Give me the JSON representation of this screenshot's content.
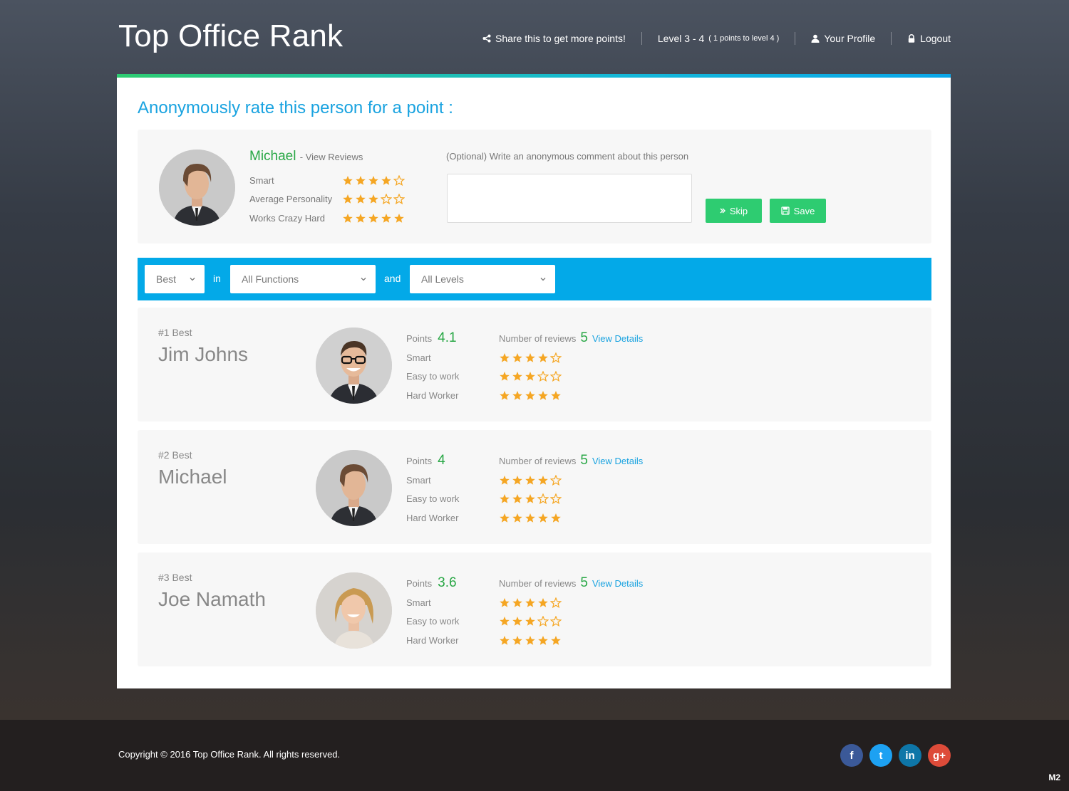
{
  "app": {
    "title": "Top Office Rank"
  },
  "nav": {
    "share_label": "Share this to get more points!",
    "level_label": "Level 3 - 4",
    "level_note": "( 1 points to level 4 )",
    "profile_label": "Your Profile",
    "logout_label": "Logout"
  },
  "rate": {
    "title": "Anonymously rate this person for a point :",
    "person_name": "Michael",
    "view_reviews": "- View Reviews",
    "traits": [
      {
        "label": "Smart",
        "rating": 4
      },
      {
        "label": "Average Personality",
        "rating": 3
      },
      {
        "label": "Works Crazy Hard",
        "rating": 5
      }
    ],
    "comment_label": "(Optional) Write an anonymous comment about this person",
    "comment_value": "",
    "skip_label": "Skip",
    "save_label": "Save"
  },
  "filters": {
    "sort_value": "Best",
    "word_in": "in",
    "function_value": "All Functions",
    "word_and": "and",
    "level_value": "All Levels"
  },
  "rankings": [
    {
      "rank_label": "#1 Best",
      "name": "Jim Johns",
      "points_label": "Points",
      "points": "4.1",
      "reviews_label": "Number of reviews",
      "reviews": "5",
      "details_label": "View Details",
      "traits": [
        {
          "label": "Smart",
          "rating": 4
        },
        {
          "label": "Easy to work",
          "rating": 3
        },
        {
          "label": "Hard Worker",
          "rating": 5
        }
      ]
    },
    {
      "rank_label": "#2 Best",
      "name": "Michael",
      "points_label": "Points",
      "points": "4",
      "reviews_label": "Number of reviews",
      "reviews": "5",
      "details_label": "View Details",
      "traits": [
        {
          "label": "Smart",
          "rating": 4
        },
        {
          "label": "Easy to work",
          "rating": 3
        },
        {
          "label": "Hard Worker",
          "rating": 5
        }
      ]
    },
    {
      "rank_label": "#3 Best",
      "name": "Joe Namath",
      "points_label": "Points",
      "points": "3.6",
      "reviews_label": "Number of reviews",
      "reviews": "5",
      "details_label": "View Details",
      "traits": [
        {
          "label": "Smart",
          "rating": 4
        },
        {
          "label": "Easy to work",
          "rating": 3
        },
        {
          "label": "Hard Worker",
          "rating": 5
        }
      ]
    }
  ],
  "footer": {
    "copyright": "Copyright  © 2016   Top Office Rank.   All rights reserved.",
    "social": [
      {
        "name": "facebook-icon",
        "glyph": "f",
        "color": "#3b5998"
      },
      {
        "name": "twitter-icon",
        "glyph": "t",
        "color": "#1da1f2"
      },
      {
        "name": "linkedin-icon",
        "glyph": "in",
        "color": "#0e76a8"
      },
      {
        "name": "google-plus-icon",
        "glyph": "g+",
        "color": "#dd4b39"
      }
    ],
    "build_tag": "M2"
  },
  "colors": {
    "accent": "#03a9e8",
    "green": "#2ecc71",
    "star": "#f5a623"
  }
}
